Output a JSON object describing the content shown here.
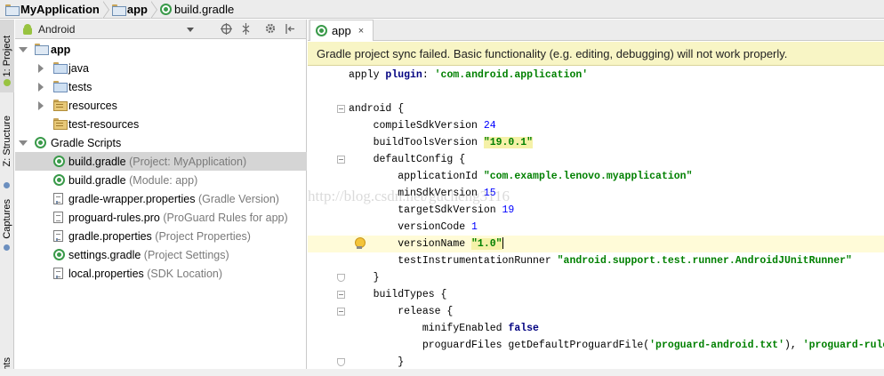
{
  "breadcrumb": [
    {
      "label": "MyApplication",
      "icon": "module-folder-icon"
    },
    {
      "label": "app",
      "icon": "module-folder-icon"
    },
    {
      "label": "build.gradle",
      "icon": "gradle-icon"
    }
  ],
  "left_strip": {
    "tabs": [
      {
        "label": "1: Project"
      },
      {
        "label": "Z: Structure"
      },
      {
        "label": "Captures"
      },
      {
        "label": "nts"
      }
    ]
  },
  "project_panel": {
    "view_selector": "Android",
    "tree": [
      {
        "label": "app",
        "hint": "",
        "level": 0,
        "twisty": "open",
        "icon": "module-folder-icon",
        "bold": true
      },
      {
        "label": "java",
        "hint": "",
        "level": 1,
        "twisty": "closed",
        "icon": "folder-icon"
      },
      {
        "label": "tests",
        "hint": "",
        "level": 1,
        "twisty": "closed",
        "icon": "folder-icon"
      },
      {
        "label": "resources",
        "hint": "",
        "level": 1,
        "twisty": "closed",
        "icon": "resources-folder-icon"
      },
      {
        "label": "test-resources",
        "hint": "",
        "level": 1,
        "twisty": "",
        "icon": "resources-folder-icon"
      },
      {
        "label": "Gradle Scripts",
        "hint": "",
        "level": 0,
        "twisty": "open",
        "icon": "gradle-icon"
      },
      {
        "label": "build.gradle",
        "hint": "(Project: MyApplication)",
        "level": 1,
        "twisty": "",
        "icon": "gradle-icon",
        "selected": true
      },
      {
        "label": "build.gradle",
        "hint": "(Module: app)",
        "level": 1,
        "twisty": "",
        "icon": "gradle-icon"
      },
      {
        "label": "gradle-wrapper.properties",
        "hint": "(Gradle Version)",
        "level": 1,
        "twisty": "",
        "icon": "properties-file-icon"
      },
      {
        "label": "proguard-rules.pro",
        "hint": "(ProGuard Rules for app)",
        "level": 1,
        "twisty": "",
        "icon": "file-icon"
      },
      {
        "label": "gradle.properties",
        "hint": "(Project Properties)",
        "level": 1,
        "twisty": "",
        "icon": "properties-file-icon"
      },
      {
        "label": "settings.gradle",
        "hint": "(Project Settings)",
        "level": 1,
        "twisty": "",
        "icon": "gradle-icon"
      },
      {
        "label": "local.properties",
        "hint": "(SDK Location)",
        "level": 1,
        "twisty": "",
        "icon": "properties-file-icon"
      }
    ]
  },
  "editor": {
    "tab": {
      "label": "app",
      "close": "×"
    },
    "banner": "Gradle project sync failed. Basic functionality (e.g. editing, debugging) will not work properly.",
    "lines": [
      [
        {
          "t": "apply ",
          "c": "plain"
        },
        {
          "t": "plugin",
          "c": "kw"
        },
        {
          "t": ": ",
          "c": "plain"
        },
        {
          "t": "'com.android.application'",
          "c": "str"
        }
      ],
      [],
      [
        {
          "t": "android {",
          "c": "plain"
        }
      ],
      [
        {
          "t": "    compileSdkVersion ",
          "c": "plain"
        },
        {
          "t": "24",
          "c": "num"
        }
      ],
      [
        {
          "t": "    buildToolsVersion ",
          "c": "plain"
        },
        {
          "t": "\"19.0.1\"",
          "c": "str hl"
        }
      ],
      [
        {
          "t": "    defaultConfig {",
          "c": "plain"
        }
      ],
      [
        {
          "t": "        applicationId ",
          "c": "plain"
        },
        {
          "t": "\"com.example.lenovo.myapplication\"",
          "c": "str"
        }
      ],
      [
        {
          "t": "        minSdkVersion ",
          "c": "plain"
        },
        {
          "t": "15",
          "c": "num"
        }
      ],
      [
        {
          "t": "        targetSdkVersion ",
          "c": "plain"
        },
        {
          "t": "19",
          "c": "num"
        }
      ],
      [
        {
          "t": "        versionCode ",
          "c": "plain"
        },
        {
          "t": "1",
          "c": "num"
        }
      ],
      [
        {
          "t": "        versionName ",
          "c": "plain"
        },
        {
          "t": "\"1.0\"",
          "c": "str hl"
        }
      ],
      [
        {
          "t": "        testInstrumentationRunner ",
          "c": "plain"
        },
        {
          "t": "\"android.support.test.runner.AndroidJUnitRunner\"",
          "c": "str"
        }
      ],
      [
        {
          "t": "    }",
          "c": "plain"
        }
      ],
      [
        {
          "t": "    buildTypes {",
          "c": "plain"
        }
      ],
      [
        {
          "t": "        release {",
          "c": "plain"
        }
      ],
      [
        {
          "t": "            minifyEnabled ",
          "c": "plain"
        },
        {
          "t": "false",
          "c": "kw"
        }
      ],
      [
        {
          "t": "            proguardFiles getDefaultProguardFile(",
          "c": "plain"
        },
        {
          "t": "'proguard-android.txt'",
          "c": "str"
        },
        {
          "t": "), ",
          "c": "plain"
        },
        {
          "t": "'proguard-rules.pro'",
          "c": "str"
        }
      ],
      [
        {
          "t": "        }",
          "c": "plain"
        }
      ]
    ],
    "caret_line": 10
  },
  "watermark": "http://blog.csdn.net/gucheng3116",
  "colors": {
    "banner_bg": "#f8f5c5",
    "keyword": "#000080",
    "string": "#008000",
    "number": "#0000ff",
    "selection": "#d5d5d5"
  }
}
